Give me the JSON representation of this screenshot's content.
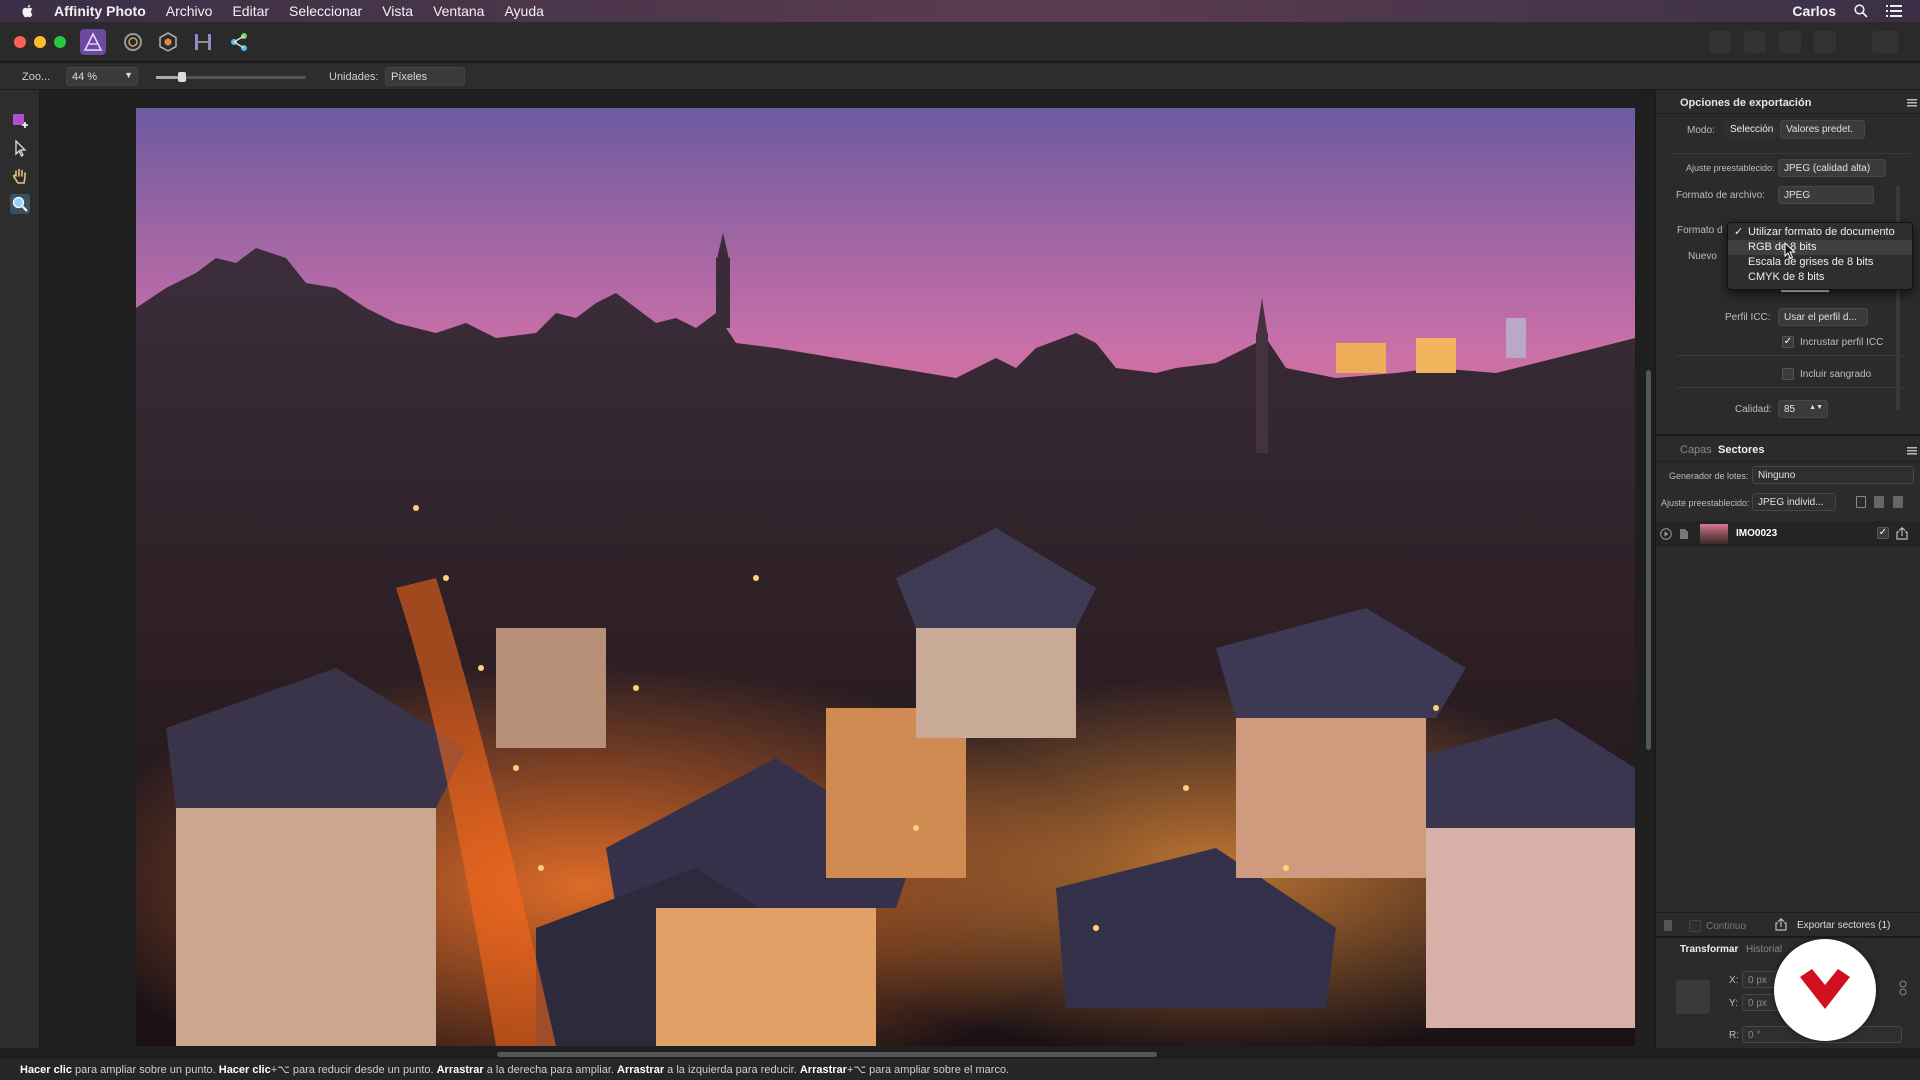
{
  "menubar": {
    "app_name": "Affinity Photo",
    "items": [
      "Archivo",
      "Editar",
      "Seleccionar",
      "Vista",
      "Ventana",
      "Ayuda"
    ],
    "user": "Carlos"
  },
  "context_toolbar": {
    "zoom_label": "Zoo...",
    "zoom_value": "44 %",
    "units_label": "Unidades:",
    "units_value": "Píxeles"
  },
  "export_panel": {
    "title": "Opciones de exportación",
    "mode_label": "Modo:",
    "mode_options": [
      "Selección",
      "Valores predet."
    ],
    "preset_label": "Ajuste preestablecido:",
    "preset_value": "JPEG (calidad alta)",
    "file_format_label": "Formato de archivo:",
    "file_format_value": "JPEG",
    "pixel_format_label": "Formato d",
    "new_label": "Nuevo",
    "icc_label": "Perfil ICC:",
    "icc_value": "Usar el perfil d...",
    "embed_icc_label": "Incrustar perfil ICC",
    "embed_icc_checked": true,
    "bleed_label": "Incluir sangrado",
    "bleed_checked": false,
    "quality_label": "Calidad:",
    "quality_value": "85"
  },
  "dropdown": {
    "options": [
      "Utilizar formato de documento",
      "RGB de 8 bits",
      "Escala de grises de 8 bits",
      "CMYK de 8 bits"
    ],
    "selected_index": 0,
    "highlight_index": 1
  },
  "slices_panel": {
    "tabs": [
      "Capas",
      "Sectores"
    ],
    "active_tab": "Sectores",
    "batch_label": "Generador de lotes:",
    "batch_value": "Ninguno",
    "preset_label": "Ajuste preestablecido:",
    "preset_value": "JPEG individ...",
    "slice_name": "IMO0023",
    "continuous_label": "Continuo",
    "export_button": "Exportar sectores (1)"
  },
  "transform_panel": {
    "tabs": [
      "Transformar",
      "Historial"
    ],
    "x_label": "X:",
    "x_value": "0 px",
    "y_label": "Y:",
    "y_value": "0 px",
    "r_label": "R:",
    "r_value": "0 °"
  },
  "statusbar": {
    "parts": [
      {
        "b": "Hacer clic",
        "t": " para ampliar sobre un punto. "
      },
      {
        "b": "Hacer clic",
        "t": "+⌥ para reducir desde un punto. "
      },
      {
        "b": "Arrastrar",
        "t": " a la derecha para ampliar. "
      },
      {
        "b": "Arrastrar",
        "t": " a la izquierda para reducir. "
      },
      {
        "b": "Arrastrar",
        "t": "+⌥ para ampliar sobre el marco."
      }
    ]
  },
  "colors": {
    "accent": "#c2185b",
    "logo_red": "#d10f1f"
  }
}
